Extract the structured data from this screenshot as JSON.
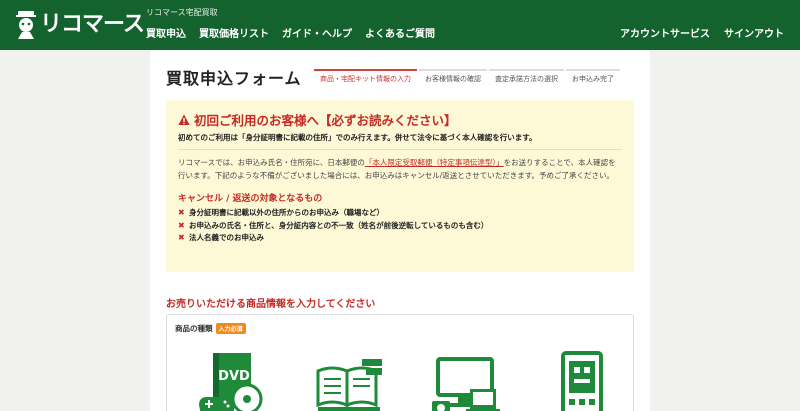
{
  "header": {
    "logo_text": "リコマース",
    "sub_brand": "リコマース宅配買取",
    "nav": [
      "買取申込",
      "買取価格リスト",
      "ガイド・ヘルプ",
      "よくあるご質問"
    ],
    "nav_right": [
      "アカウントサービス",
      "サインアウト"
    ]
  },
  "page": {
    "title": "買取申込フォーム",
    "steps": [
      "商品・宅配キット情報の入力",
      "お客様情報の確認",
      "査定承諾方法の選択",
      "お申込み完了"
    ]
  },
  "notice": {
    "title": "初回ご利用のお客様へ【必ずお読みください】",
    "lead": "初めてのご利用は「身分証明書に記載の住所」でのみ行えます。併せて法令に基づく本人確認を行います。",
    "body_pre": "リコマースでは、お申込み氏名・住所宛に、日本郵便の",
    "body_link": "「本人限定受取郵便（特定事項伝達型）」",
    "body_post": "をお送りすることで、本人確認を行います。下記のような不備がございました場合には、お申込みはキャンセル/返送とさせていただきます。予めご了承ください。",
    "cancel_title": "キャンセル / 返送の対象となるもの",
    "cancel_items": [
      "身分証明書に記載以外の住所からのお申込み（職場など）",
      "お申込みの氏名・住所と、身分証内容との不一致（姓名が前後逆転しているものも含む）",
      "法人名義でのお申込み"
    ]
  },
  "products": {
    "section_title": "お売りいただける商品情報を入力してください",
    "type_label": "商品の種類",
    "required_badge": "入力必須",
    "dvd_label": "DVD",
    "icons": [
      "dvd-game-icon",
      "books-icon",
      "pc-electronics-icon",
      "mobile-device-icon"
    ]
  },
  "colors": {
    "brand_green": "#14632e",
    "accent_red": "#c52a25",
    "notice_bg": "#fdf9d6",
    "required_orange": "#f08a1e"
  }
}
